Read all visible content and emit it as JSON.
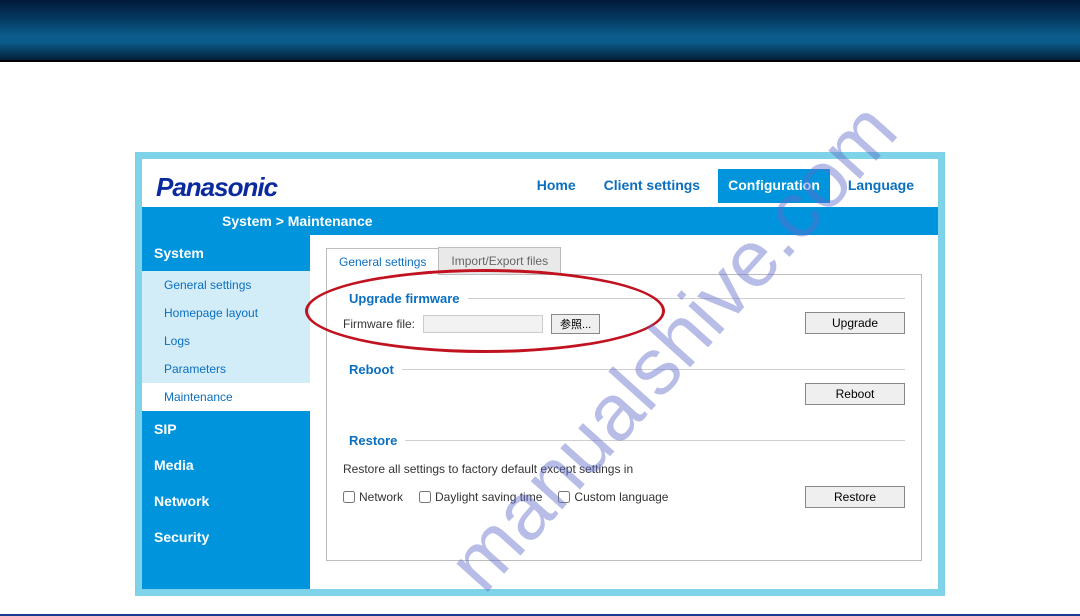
{
  "watermark": "manualshive.com",
  "brand": "Panasonic",
  "top_tabs": {
    "home": "Home",
    "client_settings": "Client settings",
    "configuration": "Configuration",
    "language": "Language"
  },
  "breadcrumb": "System  > Maintenance",
  "sidebar": {
    "sections": [
      {
        "label": "System",
        "expanded": true
      },
      {
        "label": "SIP"
      },
      {
        "label": "Media"
      },
      {
        "label": "Network"
      },
      {
        "label": "Security"
      }
    ],
    "system_items": [
      "General settings",
      "Homepage layout",
      "Logs",
      "Parameters",
      "Maintenance"
    ]
  },
  "sub_tabs": {
    "general_settings": "General settings",
    "import_export": "Import/Export files"
  },
  "upgrade": {
    "legend": "Upgrade firmware",
    "label": "Firmware file:",
    "browse": "参照...",
    "button": "Upgrade"
  },
  "reboot": {
    "legend": "Reboot",
    "button": "Reboot"
  },
  "restore": {
    "legend": "Restore",
    "text": "Restore all settings to factory default except settings in",
    "opt_network": "Network",
    "opt_dst": "Daylight saving time",
    "opt_lang": "Custom language",
    "button": "Restore"
  }
}
